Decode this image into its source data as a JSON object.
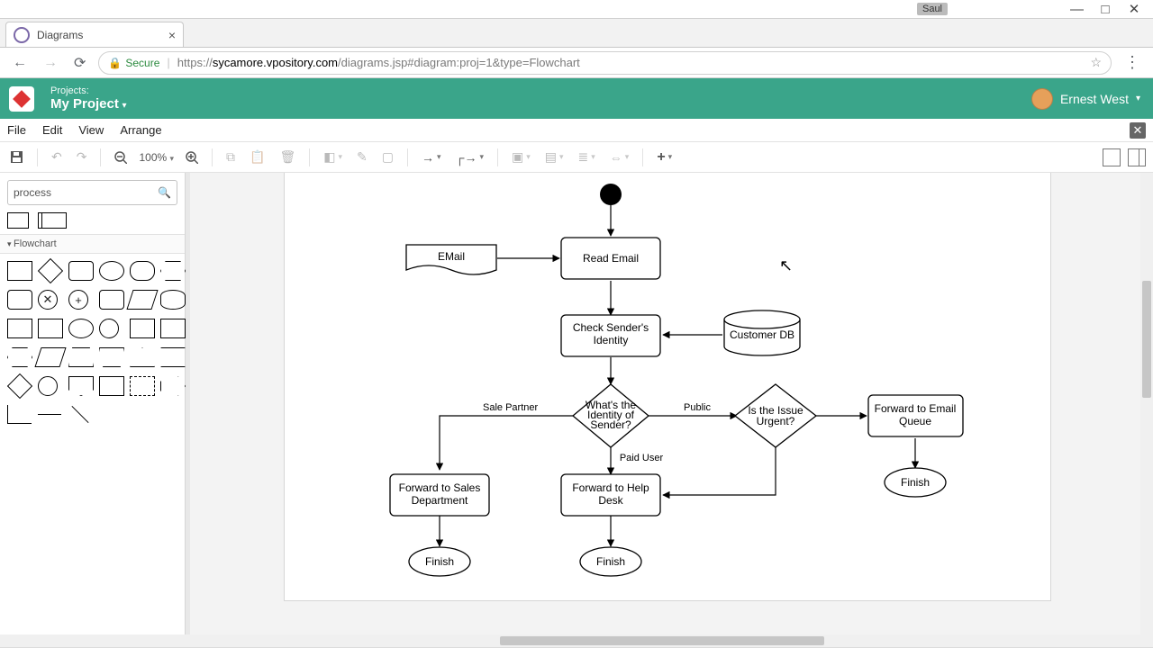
{
  "os": {
    "profile_badge": "Saul",
    "min": "—",
    "max": "□",
    "close": "✕"
  },
  "browser": {
    "tab_title": "Diagrams",
    "secure_label": "Secure",
    "url_prefix": "https://",
    "url_host": "sycamore.vpository.com",
    "url_path": "/diagrams.jsp#diagram:proj=1&type=Flowchart"
  },
  "header": {
    "projects_label": "Projects:",
    "project_name": "My Project",
    "user_name": "Ernest West"
  },
  "menubar": [
    "File",
    "Edit",
    "View",
    "Arrange"
  ],
  "toolbar": {
    "zoom": "100%"
  },
  "palette": {
    "search_value": "process",
    "section_title": "Flowchart"
  },
  "diagram": {
    "nodes": {
      "start": "",
      "email": "EMail",
      "read_email": "Read Email",
      "check_identity_l1": "Check Sender's",
      "check_identity_l2": "Identity",
      "customer_db": "Customer DB",
      "decision_identity_l1": "What's the",
      "decision_identity_l2": "Identity of",
      "decision_identity_l3": "Sender?",
      "decision_urgent_l1": "Is the Issue",
      "decision_urgent_l2": "Urgent?",
      "forward_email_l1": "Forward to Email",
      "forward_email_l2": "Queue",
      "forward_sales_l1": "Forward to Sales",
      "forward_sales_l2": "Department",
      "forward_help_l1": "Forward to Help",
      "forward_help_l2": "Desk",
      "finish1": "Finish",
      "finish2": "Finish",
      "finish3": "Finish"
    },
    "edge_labels": {
      "sale_partner": "Sale Partner",
      "paid_user": "Paid User",
      "public": "Public"
    }
  }
}
